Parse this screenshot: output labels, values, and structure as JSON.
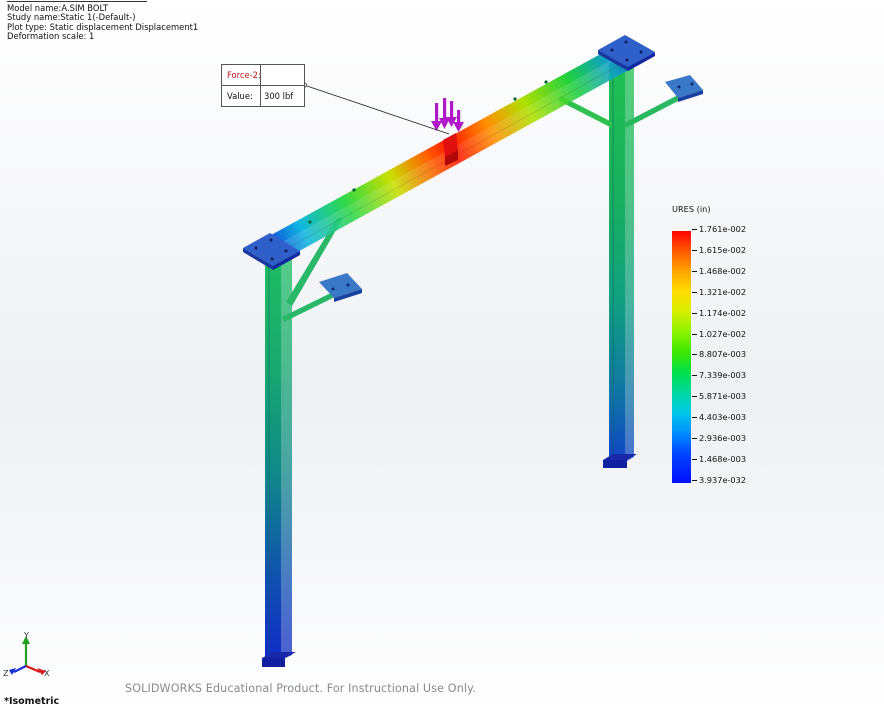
{
  "study_info": {
    "model_name": "Model name:A.SIM BOLT",
    "study_name": "Study name:Static 1(-Default-)",
    "plot_type": "Plot type: Static displacement Displacement1",
    "deformation_scale": "Deformation scale: 1"
  },
  "force_callout": {
    "title": "Force-2:",
    "value_label": "Value:",
    "value": "300 lbf"
  },
  "legend": {
    "title": "URES (in)",
    "ticks": [
      "1.761e-002",
      "1.615e-002",
      "1.468e-002",
      "1.321e-002",
      "1.174e-002",
      "1.027e-002",
      "8.807e-003",
      "7.339e-003",
      "5.871e-003",
      "4.403e-003",
      "2.936e-003",
      "1.468e-003",
      "3.937e-032"
    ]
  },
  "triad": {
    "x": "X",
    "y": "Y",
    "z": "Z"
  },
  "view_label": "*Isometric",
  "watermark": "SOLIDWORKS Educational Product. For Instructional Use Only.",
  "colors": {
    "max_displacement": "#ff0000",
    "min_displacement": "#0000ff",
    "load_arrow": "#b018c8",
    "triad_x": "#d81818",
    "triad_y": "#20a020",
    "triad_z": "#1830d0"
  }
}
